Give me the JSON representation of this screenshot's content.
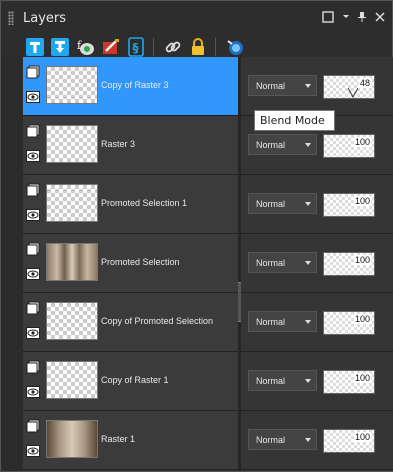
{
  "panel": {
    "title": "Layers",
    "controls": [
      "maximize-icon",
      "dropdown-icon",
      "pin-icon",
      "close-icon"
    ]
  },
  "toolbar": {
    "tools": [
      "new-raster-layer-icon",
      "new-vector-layer-icon",
      "new-adjustment-layer-icon",
      "new-mask-layer-icon",
      "new-group-icon",
      "link-icon",
      "lock-icon",
      "delete-layer-icon"
    ]
  },
  "layers": [
    {
      "name": "Copy of Raster 3",
      "blend_mode": "Normal",
      "opacity": "48",
      "selected": true
    },
    {
      "name": "Raster 3",
      "blend_mode": "Normal",
      "opacity": "100",
      "selected": false
    },
    {
      "name": "Promoted Selection 1",
      "blend_mode": "Normal",
      "opacity": "100",
      "selected": false
    },
    {
      "name": "Promoted Selection",
      "blend_mode": "Normal",
      "opacity": "100",
      "selected": false
    },
    {
      "name": "Copy of Promoted Selection",
      "blend_mode": "Normal",
      "opacity": "100",
      "selected": false
    },
    {
      "name": "Copy of Raster 1",
      "blend_mode": "Normal",
      "opacity": "100",
      "selected": false
    },
    {
      "name": "Raster 1",
      "blend_mode": "Normal",
      "opacity": "100",
      "selected": false
    }
  ],
  "tooltip": {
    "text": "Blend Mode"
  },
  "colors": {
    "selected": "#3297fd",
    "panel": "#333333",
    "accent_tool": "#1fa8f0"
  }
}
